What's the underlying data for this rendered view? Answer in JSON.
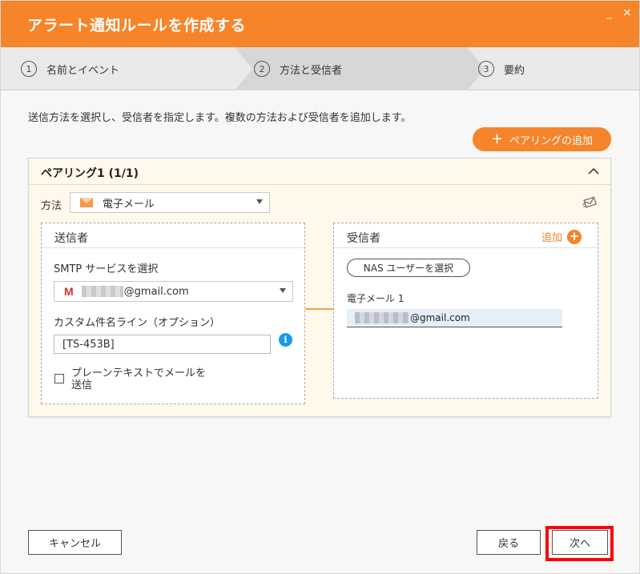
{
  "dialog": {
    "title": "アラート通知ルールを作成する",
    "window_controls": {
      "minimize": "_",
      "close": "×"
    }
  },
  "steps": [
    {
      "number": "1",
      "label": "名前とイベント"
    },
    {
      "number": "2",
      "label": "方法と受信者"
    },
    {
      "number": "3",
      "label": "要約"
    }
  ],
  "instruction": "送信方法を選択し、受信者を指定します。複数の方法および受信者を追加します。",
  "add_pairing": {
    "label": "ペアリングの追加",
    "icon": "plus-icon"
  },
  "pairing": {
    "title": "ペアリング1 (1/1)",
    "method_label": "方法",
    "method_value": "電子メール",
    "method_icon": "envelope-icon",
    "test_icon": "send-test-icon",
    "sender": {
      "title": "送信者",
      "smtp_label": "SMTP サービスを選択",
      "smtp_value": "@gmail.com",
      "smtp_icon": "gmail-icon",
      "subject_label": "カスタム件名ライン（オプション）",
      "subject_value": "[TS-453B]",
      "info_icon": "i",
      "plaintext_label": "プレーンテキストでメールを送信",
      "plaintext_checked": false
    },
    "receiver": {
      "title": "受信者",
      "add_label": "追加",
      "add_icon": "+",
      "nas_user_button": "NAS ユーザーを選択",
      "email1_label": "電子メール 1",
      "email1_value": "@gmail.com"
    }
  },
  "footer": {
    "cancel": "キャンセル",
    "back": "戻る",
    "next": "次へ"
  },
  "colors": {
    "accent": "#f5842a",
    "highlight": "#ff0000",
    "info": "#1a9be6"
  }
}
